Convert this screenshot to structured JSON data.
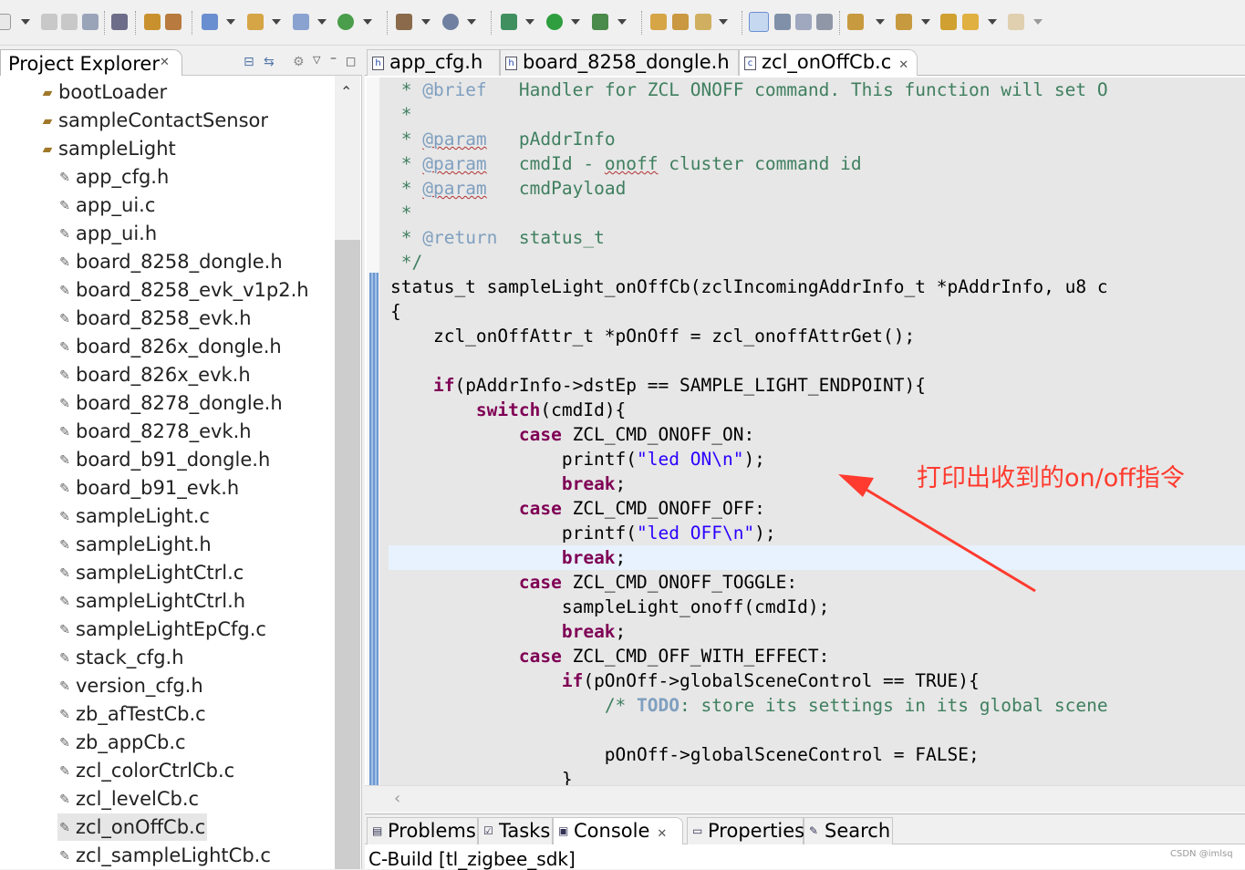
{
  "toolbar": {
    "icons": [
      "new-icon",
      "save-icon",
      "save-all-icon",
      "print-icon",
      "binary-icon",
      "build-icon",
      "debug-bug-icon",
      "new-class-icon",
      "new-folder-icon",
      "new-file-icon",
      "refresh-icon",
      "hammer-icon",
      "target-icon",
      "bug-icon",
      "run-icon",
      "external-tools-icon",
      "open-type-icon",
      "open-folder-icon",
      "search-icon",
      "pen-icon",
      "mark-icon",
      "whitespace-icon",
      "paragraph-icon",
      "next-annotation-icon",
      "prev-annotation-icon",
      "back-icon",
      "forward-icon"
    ]
  },
  "project_explorer": {
    "title": "Project Explorer",
    "projects": [
      {
        "label": "bootLoader"
      },
      {
        "label": "sampleContactSensor"
      },
      {
        "label": "sampleLight"
      }
    ],
    "files": [
      {
        "label": "app_cfg.h"
      },
      {
        "label": "app_ui.c"
      },
      {
        "label": "app_ui.h"
      },
      {
        "label": "board_8258_dongle.h"
      },
      {
        "label": "board_8258_evk_v1p2.h"
      },
      {
        "label": "board_8258_evk.h"
      },
      {
        "label": "board_826x_dongle.h"
      },
      {
        "label": "board_826x_evk.h"
      },
      {
        "label": "board_8278_dongle.h"
      },
      {
        "label": "board_8278_evk.h"
      },
      {
        "label": "board_b91_dongle.h"
      },
      {
        "label": "board_b91_evk.h"
      },
      {
        "label": "sampleLight.c"
      },
      {
        "label": "sampleLight.h"
      },
      {
        "label": "sampleLightCtrl.c"
      },
      {
        "label": "sampleLightCtrl.h"
      },
      {
        "label": "sampleLightEpCfg.c"
      },
      {
        "label": "stack_cfg.h"
      },
      {
        "label": "version_cfg.h"
      },
      {
        "label": "zb_afTestCb.c"
      },
      {
        "label": "zb_appCb.c"
      },
      {
        "label": "zcl_colorCtrlCb.c"
      },
      {
        "label": "zcl_levelCb.c"
      },
      {
        "label": "zcl_onOffCb.c"
      },
      {
        "label": "zcl_sampleLightCb.c"
      }
    ],
    "selected": "zcl_onOffCb.c"
  },
  "editor": {
    "tabs": [
      {
        "label": "app_cfg.h"
      },
      {
        "label": "board_8258_dongle.h"
      },
      {
        "label": "zcl_onOffCb.c"
      }
    ],
    "active_tab": "zcl_onOffCb.c",
    "code": {
      "l1_star": " * ",
      "l1_tag": "@brief",
      "l1_text": "   Handler for ZCL ONOFF command. This function will set O",
      "l2": " *",
      "l3_star": " * ",
      "l3_tag": "@param",
      "l3_text": "   pAddrInfo",
      "l4_star": " * ",
      "l4_tag": "@param",
      "l4_text_a": "   cmdId - ",
      "l4_squig": "onoff",
      "l4_text_b": " cluster command id",
      "l5_star": " * ",
      "l5_tag": "@param",
      "l5_text": "   cmdPayload",
      "l6": " *",
      "l7_star": " * ",
      "l7_tag": "@return",
      "l7_text": "  status_t",
      "l8": " */",
      "l9": "status_t sampleLight_onOffCb(zclIncomingAddrInfo_t *pAddrInfo, u8 c",
      "l10": "{",
      "l11": "    zcl_onOffAttr_t *pOnOff = zcl_onoffAttrGet();",
      "l13_indent": "    ",
      "l13_kw": "if",
      "l13_text": "(pAddrInfo->dstEp == SAMPLE_LIGHT_ENDPOINT){",
      "l14_indent": "        ",
      "l14_kw": "switch",
      "l14_text": "(cmdId){",
      "l15_indent": "            ",
      "l15_kw": "case",
      "l15_text": " ZCL_CMD_ONOFF_ON:",
      "l16_indent": "                printf(",
      "l16_str": "\"led ON\\n\"",
      "l16_end": ");",
      "l17_indent": "                ",
      "l17_kw": "break",
      "l17_end": ";",
      "l18_indent": "            ",
      "l18_kw": "case",
      "l18_text": " ZCL_CMD_ONOFF_OFF:",
      "l19_indent": "                printf(",
      "l19_str": "\"led OFF\\n\"",
      "l19_end": ");",
      "l20_indent": "                ",
      "l20_kw": "break",
      "l20_end": ";",
      "l21_indent": "            ",
      "l21_kw": "case",
      "l21_text": " ZCL_CMD_ONOFF_TOGGLE:",
      "l22": "                sampleLight_onoff(cmdId);",
      "l23_indent": "                ",
      "l23_kw": "break",
      "l23_end": ";",
      "l24_indent": "            ",
      "l24_kw": "case",
      "l24_text": " ZCL_CMD_OFF_WITH_EFFECT:",
      "l25_indent": "                ",
      "l25_kw": "if",
      "l25_text": "(pOnOff->globalSceneControl == TRUE){",
      "l26_indent": "                    ",
      "l26_cm": "/* ",
      "l26_todo": "TODO",
      "l26_rest": ": store its settings in its global scene",
      "l28": "                    pOnOff->globalSceneControl = FALSE;",
      "l29": "                }"
    }
  },
  "annotation": {
    "text": "打印出收到的on/off指令",
    "color": "#ff3b2f"
  },
  "bottom_panel": {
    "tabs": [
      {
        "label": "Problems",
        "icon": "problems-icon"
      },
      {
        "label": "Tasks",
        "icon": "tasks-icon"
      },
      {
        "label": "Console",
        "icon": "console-icon"
      },
      {
        "label": "Properties",
        "icon": "properties-icon"
      },
      {
        "label": "Search",
        "icon": "search-icon"
      }
    ],
    "active_tab": "Console",
    "console_title": "C-Build [tl_zigbee_sdk]"
  },
  "watermark": "CSDN @imlsq"
}
